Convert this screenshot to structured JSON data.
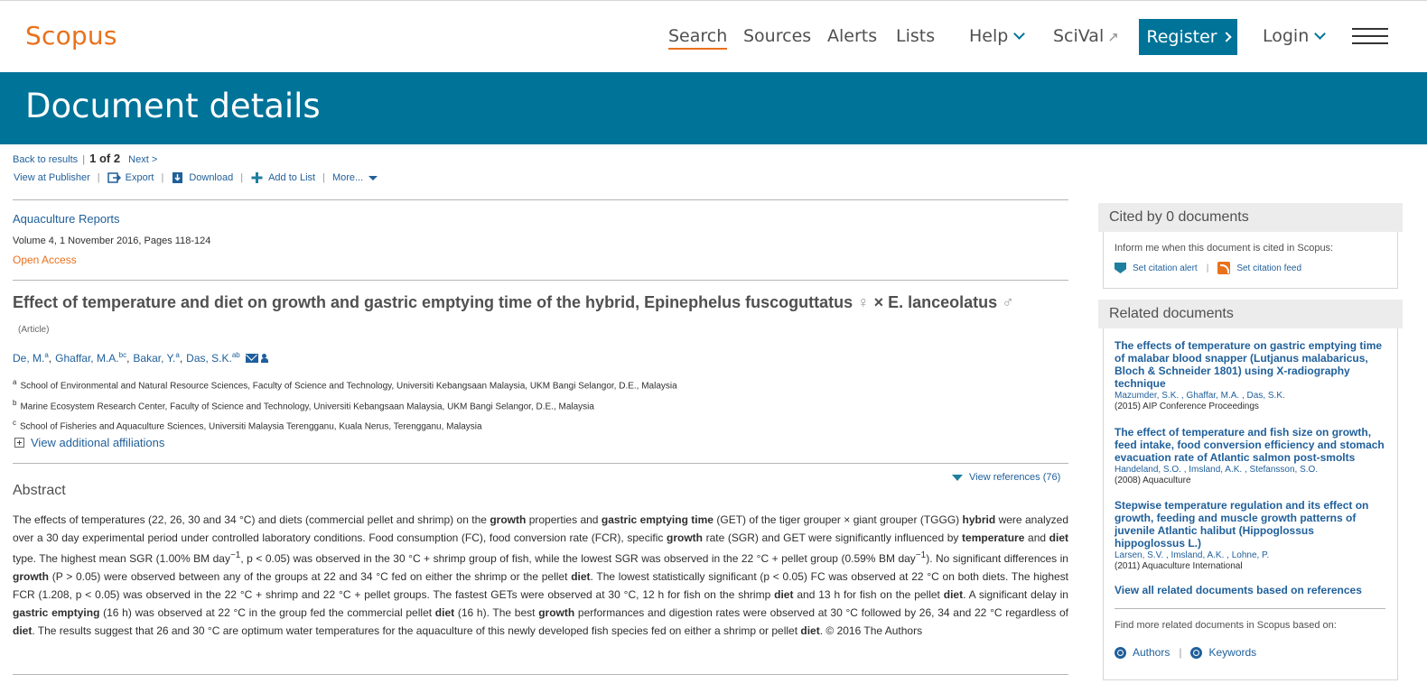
{
  "header": {
    "logo": "Scopus",
    "nav": [
      {
        "label": "Search",
        "active": true
      },
      {
        "label": "Sources"
      },
      {
        "label": "Alerts"
      },
      {
        "label": "Lists"
      },
      {
        "label": "Help"
      },
      {
        "label": "SciVal"
      }
    ],
    "register": "Register",
    "login": "Login",
    "accent": "#e9711c",
    "brand": "#007398"
  },
  "banner": {
    "title": "Document details"
  },
  "result_nav": {
    "back": "Back to results",
    "count": "1 of 2",
    "next": "Next >"
  },
  "toolbar": {
    "view_publisher": "View at Publisher",
    "export": "Export",
    "download": "Download",
    "add_to_list": "Add to List",
    "more": "More..."
  },
  "document": {
    "source": "Aquaculture Reports",
    "volume": "Volume 4, 1 November 2016, Pages 118-124",
    "open_access": "Open Access",
    "title": "Effect of temperature and diet on growth and gastric emptying time of the hybrid, Epinephelus fuscoguttatus",
    "female_symbol": "♀",
    "cross": "× E. lanceolatus",
    "male_symbol": "♂",
    "type": "(Article)",
    "authors": [
      {
        "name": "De, M.",
        "sup": "a"
      },
      {
        "name": "Ghaffar, M.A.",
        "sup": "bc"
      },
      {
        "name": "Bakar, Y.",
        "sup": "a"
      },
      {
        "name": "Das, S.K.",
        "sup": "ab"
      }
    ],
    "affiliations": [
      {
        "sup": "a",
        "text": "School of Environmental and Natural Resource Sciences, Faculty of Science and Technology, Universiti Kebangsaan Malaysia, UKM Bangi Selangor, D.E., Malaysia"
      },
      {
        "sup": "b",
        "text": "Marine Ecosystem Research Center, Faculty of Science and Technology, Universiti Kebangsaan Malaysia, UKM Bangi Selangor, D.E., Malaysia"
      },
      {
        "sup": "c",
        "text": "School of Fisheries and Aquaculture Sciences, Universiti Malaysia Terengganu, Kuala Nerus, Terengganu, Malaysia"
      }
    ],
    "more_affiliations": "View additional affiliations",
    "view_references": "View references (76)",
    "abstract_heading": "Abstract"
  },
  "sidebar": {
    "cited_by": "Cited by 0 documents",
    "inform": "Inform me when this document is cited in Scopus:",
    "citation_alert": "Set citation alert",
    "citation_feed": "Set citation feed",
    "related_heading": "Related documents",
    "related": [
      {
        "title": "The effects of temperature on gastric emptying time of malabar blood snapper (Lutjanus malabaricus, Bloch & Schneider 1801) using X-radiography technique",
        "authors": "Mazumder, S.K. , Ghaffar, M.A. , Das, S.K.",
        "source": "(2015) AIP Conference Proceedings"
      },
      {
        "title": "The effect of temperature and fish size on growth, feed intake, food conversion efficiency and stomach evacuation rate of Atlantic salmon post-smolts",
        "authors": "Handeland, S.O. , Imsland, A.K. , Stefansson, S.O.",
        "source": "(2008) Aquaculture"
      },
      {
        "title": "Stepwise temperature regulation and its effect on growth, feeding and muscle growth patterns of juvenile Atlantic halibut (Hippoglossus hippoglossus L.)",
        "authors": "Larsen, S.V. , Imsland, A.K. , Lohne, P.",
        "source": "(2011) Aquaculture International"
      }
    ],
    "view_all": "View all related documents based on references",
    "find_more": "Find more related documents in Scopus based on:",
    "authors_link": "Authors",
    "keywords_link": "Keywords"
  }
}
